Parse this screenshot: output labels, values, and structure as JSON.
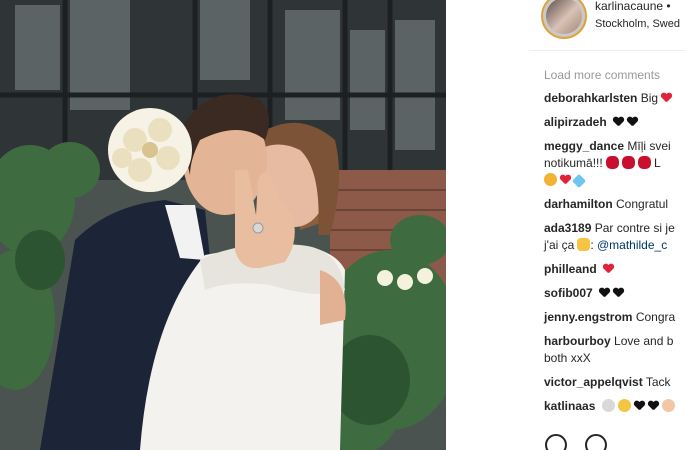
{
  "post": {
    "username": "karlinacaune",
    "location": "Stockholm, Swed",
    "load_more": "Load more comments"
  },
  "comments": [
    {
      "user": "deborahkarlsten",
      "text": "Big",
      "icons": [
        "heart-red"
      ]
    },
    {
      "user": "alipirzadeh",
      "text": "",
      "icons": [
        "heart-black",
        "heart-black"
      ]
    },
    {
      "user": "meggy_dance",
      "text": "Mīļi svei",
      "line2": "notikumā!!!",
      "icons2": [
        "lips",
        "lips",
        "lips"
      ],
      "line2_tail": "L",
      "line3_icons": [
        "couple",
        "heart-red",
        "diamond"
      ]
    },
    {
      "user": "darhamilton",
      "text": "Congratul"
    },
    {
      "user": "ada3189",
      "text": "Par contre si je",
      "line2": "j'ai ça",
      "line2_icons": [
        "finger"
      ],
      "mention": "@mathilde_c"
    },
    {
      "user": "philleand",
      "text": "",
      "icons": [
        "heart-red"
      ]
    },
    {
      "user": "sofib007",
      "text": "",
      "icons": [
        "heart-black",
        "heart-black"
      ]
    },
    {
      "user": "jenny.engstrom",
      "text": "Congra"
    },
    {
      "user": "harbourboy",
      "text": "Love and b",
      "line2": "both xxX"
    },
    {
      "user": "victor_appelqvist",
      "text": "Tack"
    },
    {
      "user": "katlinaas",
      "text": "",
      "icons": [
        "face",
        "face",
        "heart-black",
        "heart-black",
        "face"
      ]
    }
  ],
  "colors": {
    "heart_red": "#e0223a",
    "heart_black": "#111111",
    "mention": "#003569",
    "muted": "#999999"
  }
}
